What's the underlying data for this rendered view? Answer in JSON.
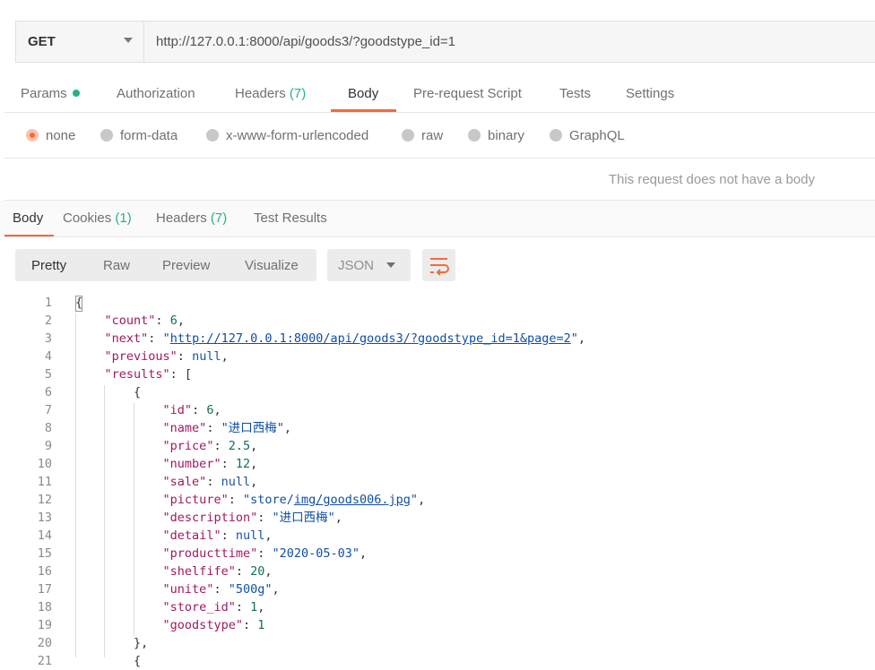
{
  "request": {
    "method": "GET",
    "url": "http://127.0.0.1:8000/api/goods3/?goodstype_id=1"
  },
  "request_tabs": {
    "params": "Params",
    "authorization": "Authorization",
    "headers": "Headers",
    "headers_count": "(7)",
    "body": "Body",
    "prerequest": "Pre-request Script",
    "tests": "Tests",
    "settings": "Settings"
  },
  "body_types": {
    "none": "none",
    "form_data": "form-data",
    "urlencoded": "x-www-form-urlencoded",
    "raw": "raw",
    "binary": "binary",
    "graphql": "GraphQL",
    "selected": "none"
  },
  "no_body_message": "This request does not have a body",
  "response_tabs": {
    "body": "Body",
    "cookies": "Cookies",
    "cookies_count": "(1)",
    "headers": "Headers",
    "headers_count": "(7)",
    "test_results": "Test Results"
  },
  "response_views": {
    "pretty": "Pretty",
    "raw": "Raw",
    "preview": "Preview",
    "visualize": "Visualize",
    "format": "JSON"
  },
  "colors": {
    "accent": "#f26b3a",
    "count_green": "#26b47f",
    "json_key": "#a0195f",
    "json_string": "#0e4ea8",
    "json_number": "#107052"
  },
  "code_lines": [
    {
      "n": "1",
      "parts": [
        {
          "t": "{",
          "c": "p"
        }
      ]
    },
    {
      "n": "2",
      "parts": [
        {
          "t": "    ",
          "c": "p"
        },
        {
          "t": "\"count\"",
          "c": "key"
        },
        {
          "t": ": ",
          "c": "p"
        },
        {
          "t": "6",
          "c": "num"
        },
        {
          "t": ",",
          "c": "p"
        }
      ]
    },
    {
      "n": "3",
      "parts": [
        {
          "t": "    ",
          "c": "p"
        },
        {
          "t": "\"next\"",
          "c": "key"
        },
        {
          "t": ": ",
          "c": "p"
        },
        {
          "t": "\"",
          "c": "str"
        },
        {
          "t": "http://127.0.0.1:8000/api/goods3/?goodstype_id=1&page=2",
          "c": "str link"
        },
        {
          "t": "\"",
          "c": "str"
        },
        {
          "t": ",",
          "c": "p"
        }
      ]
    },
    {
      "n": "4",
      "parts": [
        {
          "t": "    ",
          "c": "p"
        },
        {
          "t": "\"previous\"",
          "c": "key"
        },
        {
          "t": ": ",
          "c": "p"
        },
        {
          "t": "null",
          "c": "kw"
        },
        {
          "t": ",",
          "c": "p"
        }
      ]
    },
    {
      "n": "5",
      "parts": [
        {
          "t": "    ",
          "c": "p"
        },
        {
          "t": "\"results\"",
          "c": "key"
        },
        {
          "t": ": [",
          "c": "p"
        }
      ]
    },
    {
      "n": "6",
      "parts": [
        {
          "t": "        {",
          "c": "p"
        }
      ]
    },
    {
      "n": "7",
      "parts": [
        {
          "t": "            ",
          "c": "p"
        },
        {
          "t": "\"id\"",
          "c": "key"
        },
        {
          "t": ": ",
          "c": "p"
        },
        {
          "t": "6",
          "c": "num"
        },
        {
          "t": ",",
          "c": "p"
        }
      ]
    },
    {
      "n": "8",
      "parts": [
        {
          "t": "            ",
          "c": "p"
        },
        {
          "t": "\"name\"",
          "c": "key"
        },
        {
          "t": ": ",
          "c": "p"
        },
        {
          "t": "\"进口西梅\"",
          "c": "str"
        },
        {
          "t": ",",
          "c": "p"
        }
      ]
    },
    {
      "n": "9",
      "parts": [
        {
          "t": "            ",
          "c": "p"
        },
        {
          "t": "\"price\"",
          "c": "key"
        },
        {
          "t": ": ",
          "c": "p"
        },
        {
          "t": "2.5",
          "c": "num"
        },
        {
          "t": ",",
          "c": "p"
        }
      ]
    },
    {
      "n": "10",
      "parts": [
        {
          "t": "            ",
          "c": "p"
        },
        {
          "t": "\"number\"",
          "c": "key"
        },
        {
          "t": ": ",
          "c": "p"
        },
        {
          "t": "12",
          "c": "num"
        },
        {
          "t": ",",
          "c": "p"
        }
      ]
    },
    {
      "n": "11",
      "parts": [
        {
          "t": "            ",
          "c": "p"
        },
        {
          "t": "\"sale\"",
          "c": "key"
        },
        {
          "t": ": ",
          "c": "p"
        },
        {
          "t": "null",
          "c": "kw"
        },
        {
          "t": ",",
          "c": "p"
        }
      ]
    },
    {
      "n": "12",
      "parts": [
        {
          "t": "            ",
          "c": "p"
        },
        {
          "t": "\"picture\"",
          "c": "key"
        },
        {
          "t": ": ",
          "c": "p"
        },
        {
          "t": "\"store/",
          "c": "str"
        },
        {
          "t": "img/goods006.jpg",
          "c": "str link"
        },
        {
          "t": "\"",
          "c": "str"
        },
        {
          "t": ",",
          "c": "p"
        }
      ]
    },
    {
      "n": "13",
      "parts": [
        {
          "t": "            ",
          "c": "p"
        },
        {
          "t": "\"description\"",
          "c": "key"
        },
        {
          "t": ": ",
          "c": "p"
        },
        {
          "t": "\"进口西梅\"",
          "c": "str"
        },
        {
          "t": ",",
          "c": "p"
        }
      ]
    },
    {
      "n": "14",
      "parts": [
        {
          "t": "            ",
          "c": "p"
        },
        {
          "t": "\"detail\"",
          "c": "key"
        },
        {
          "t": ": ",
          "c": "p"
        },
        {
          "t": "null",
          "c": "kw"
        },
        {
          "t": ",",
          "c": "p"
        }
      ]
    },
    {
      "n": "15",
      "parts": [
        {
          "t": "            ",
          "c": "p"
        },
        {
          "t": "\"producttime\"",
          "c": "key"
        },
        {
          "t": ": ",
          "c": "p"
        },
        {
          "t": "\"2020-05-03\"",
          "c": "str"
        },
        {
          "t": ",",
          "c": "p"
        }
      ]
    },
    {
      "n": "16",
      "parts": [
        {
          "t": "            ",
          "c": "p"
        },
        {
          "t": "\"shelfife\"",
          "c": "key"
        },
        {
          "t": ": ",
          "c": "p"
        },
        {
          "t": "20",
          "c": "num"
        },
        {
          "t": ",",
          "c": "p"
        }
      ]
    },
    {
      "n": "17",
      "parts": [
        {
          "t": "            ",
          "c": "p"
        },
        {
          "t": "\"unite\"",
          "c": "key"
        },
        {
          "t": ": ",
          "c": "p"
        },
        {
          "t": "\"500g\"",
          "c": "str"
        },
        {
          "t": ",",
          "c": "p"
        }
      ]
    },
    {
      "n": "18",
      "parts": [
        {
          "t": "            ",
          "c": "p"
        },
        {
          "t": "\"store_id\"",
          "c": "key"
        },
        {
          "t": ": ",
          "c": "p"
        },
        {
          "t": "1",
          "c": "num"
        },
        {
          "t": ",",
          "c": "p"
        }
      ]
    },
    {
      "n": "19",
      "parts": [
        {
          "t": "            ",
          "c": "p"
        },
        {
          "t": "\"goodstype\"",
          "c": "key"
        },
        {
          "t": ": ",
          "c": "p"
        },
        {
          "t": "1",
          "c": "num"
        }
      ]
    },
    {
      "n": "20",
      "parts": [
        {
          "t": "        },",
          "c": "p"
        }
      ]
    },
    {
      "n": "21",
      "parts": [
        {
          "t": "        {",
          "c": "p"
        }
      ]
    }
  ]
}
